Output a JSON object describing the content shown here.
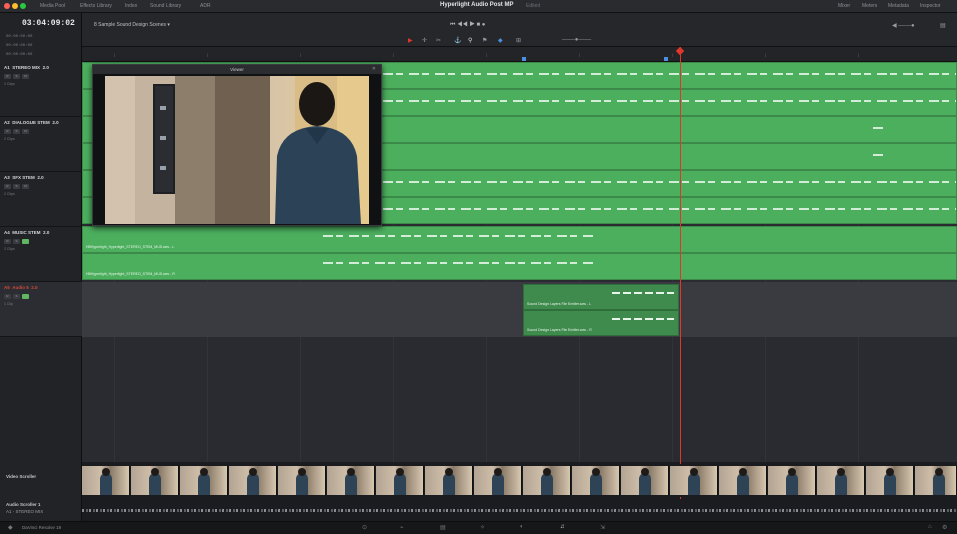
{
  "menubar": {
    "left_tabs": [
      "Media Pool",
      "Effects Library",
      "Index",
      "Sound Library",
      "ADR"
    ],
    "title": "Hyperlight Audio Post MP",
    "subtitle": "Edited",
    "right_tabs": [
      "Mixer",
      "Meters",
      "Metadata",
      "Inspector"
    ]
  },
  "toolbar": {
    "timeline_name": "8 Sample Sound Design Scenes ▾"
  },
  "leftpanel": {
    "timecode": "03:04:09:02",
    "subcodes": [
      "00:00:00:00",
      "00:00:00:00",
      "00:00:00:00"
    ]
  },
  "tracks": [
    {
      "id": "A1",
      "name": "STEREO MIX",
      "channel": "2.0",
      "meta": "2 Clips"
    },
    {
      "id": "A2",
      "name": "DIALOGUE STEM",
      "channel": "2.0",
      "meta": "2 Clips"
    },
    {
      "id": "A3",
      "name": "SFX STEM",
      "channel": "2.0",
      "meta": "2 Clips"
    },
    {
      "id": "A4",
      "name": "MUSIC STEM",
      "channel": "2.0",
      "meta": "2 Clips"
    },
    {
      "id": "A5",
      "name": "Audio 5",
      "channel": "2.0",
      "meta": "1 Clip"
    }
  ],
  "clips": {
    "music_1": "HBHyperlight_Hyperlight_STEREO_STEM_MUS.wav - L",
    "music_2": "HBHyperlight_Hyperlight_STEREO_STEM_MUS.wav - R",
    "sfx_1": "Sound Design Layers File Emitter.wav - L",
    "sfx_2": "Sound Design Layers File Emitter.wav - R"
  },
  "viewer": {
    "title": "Viewer"
  },
  "bottom": {
    "video_scroller_label": "Video Scroller",
    "audio_scroller_label": "Audio Scroller 1",
    "audio_scroller_track": "A1 - STEREO MIX",
    "brand": "DaVinci Resolve 19"
  },
  "colors": {
    "clip_green": "#4caf5e",
    "playhead": "#e0362b",
    "background": "#1b1c1f"
  }
}
